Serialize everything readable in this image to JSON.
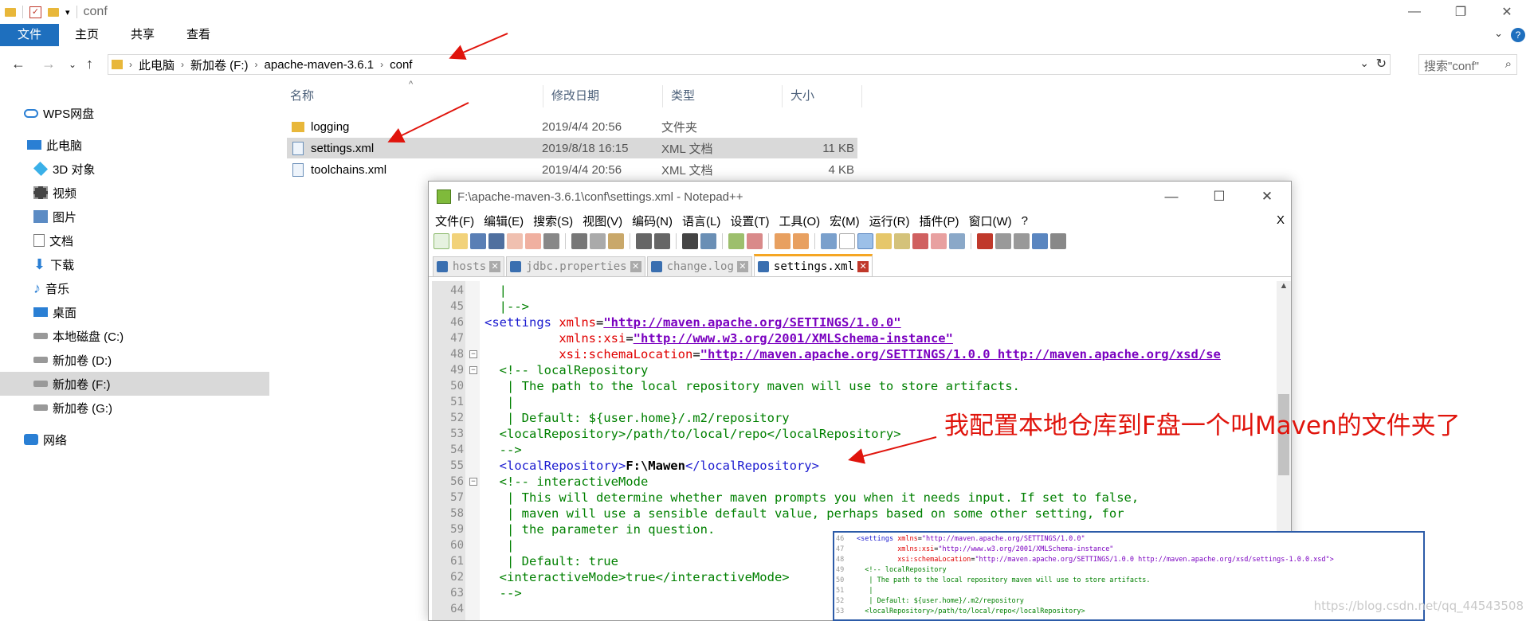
{
  "explorer": {
    "title": "conf",
    "ribbon_tabs": [
      "文件",
      "主页",
      "共享",
      "查看"
    ],
    "breadcrumb": [
      "此电脑",
      "新加卷 (F:)",
      "apache-maven-3.6.1",
      "conf"
    ],
    "search_placeholder": "搜索\"conf\"",
    "nav_items": [
      {
        "label": "WPS网盘",
        "icon": "cloud-icon"
      },
      {
        "label": "此电脑",
        "icon": "computer-icon"
      },
      {
        "label": "3D 对象",
        "icon": "3d-objects-icon"
      },
      {
        "label": "视频",
        "icon": "video-icon"
      },
      {
        "label": "图片",
        "icon": "pictures-icon"
      },
      {
        "label": "文档",
        "icon": "documents-icon"
      },
      {
        "label": "下载",
        "icon": "download-icon"
      },
      {
        "label": "音乐",
        "icon": "music-icon"
      },
      {
        "label": "桌面",
        "icon": "desktop-icon"
      },
      {
        "label": "本地磁盘 (C:)",
        "icon": "drive-icon"
      },
      {
        "label": "新加卷 (D:)",
        "icon": "drive-icon"
      },
      {
        "label": "新加卷 (F:)",
        "icon": "drive-icon",
        "selected": true
      },
      {
        "label": "新加卷 (G:)",
        "icon": "drive-icon"
      },
      {
        "label": "网络",
        "icon": "network-icon"
      }
    ],
    "columns": [
      "名称",
      "修改日期",
      "类型",
      "大小"
    ],
    "files": [
      {
        "name": "logging",
        "date": "2019/4/4 20:56",
        "type": "文件夹",
        "size": "",
        "icon": "folder-icon"
      },
      {
        "name": "settings.xml",
        "date": "2019/8/18 16:15",
        "type": "XML 文档",
        "size": "11 KB",
        "icon": "xml-file-icon",
        "selected": true
      },
      {
        "name": "toolchains.xml",
        "date": "2019/4/4 20:56",
        "type": "XML 文档",
        "size": "4 KB",
        "icon": "xml-file-icon"
      }
    ]
  },
  "notepad": {
    "title": "F:\\apache-maven-3.6.1\\conf\\settings.xml - Notepad++",
    "menu": [
      "文件(F)",
      "编辑(E)",
      "搜索(S)",
      "视图(V)",
      "编码(N)",
      "语言(L)",
      "设置(T)",
      "工具(O)",
      "宏(M)",
      "运行(R)",
      "插件(P)",
      "窗口(W)",
      "?"
    ],
    "menu_close": "X",
    "tabs": [
      {
        "label": "hosts",
        "active": false
      },
      {
        "label": "jdbc.properties",
        "active": false
      },
      {
        "label": "change.log",
        "active": false
      },
      {
        "label": "settings.xml",
        "active": true
      }
    ],
    "line_numbers": [
      "44",
      "45",
      "46",
      "47",
      "48",
      "49",
      "50",
      "51",
      "52",
      "53",
      "54",
      "55",
      "56",
      "57",
      "58",
      "59",
      "60",
      "61",
      "62",
      "63",
      "64"
    ]
  },
  "annotation": "我配置本地仓库到F盘一个叫Maven的文件夹了",
  "watermark": "https://blog.csdn.net/qq_44543508",
  "colors": {
    "accent": "#1e6fbe",
    "annotation": "#e0140c",
    "tab_active": "#f5a623"
  }
}
